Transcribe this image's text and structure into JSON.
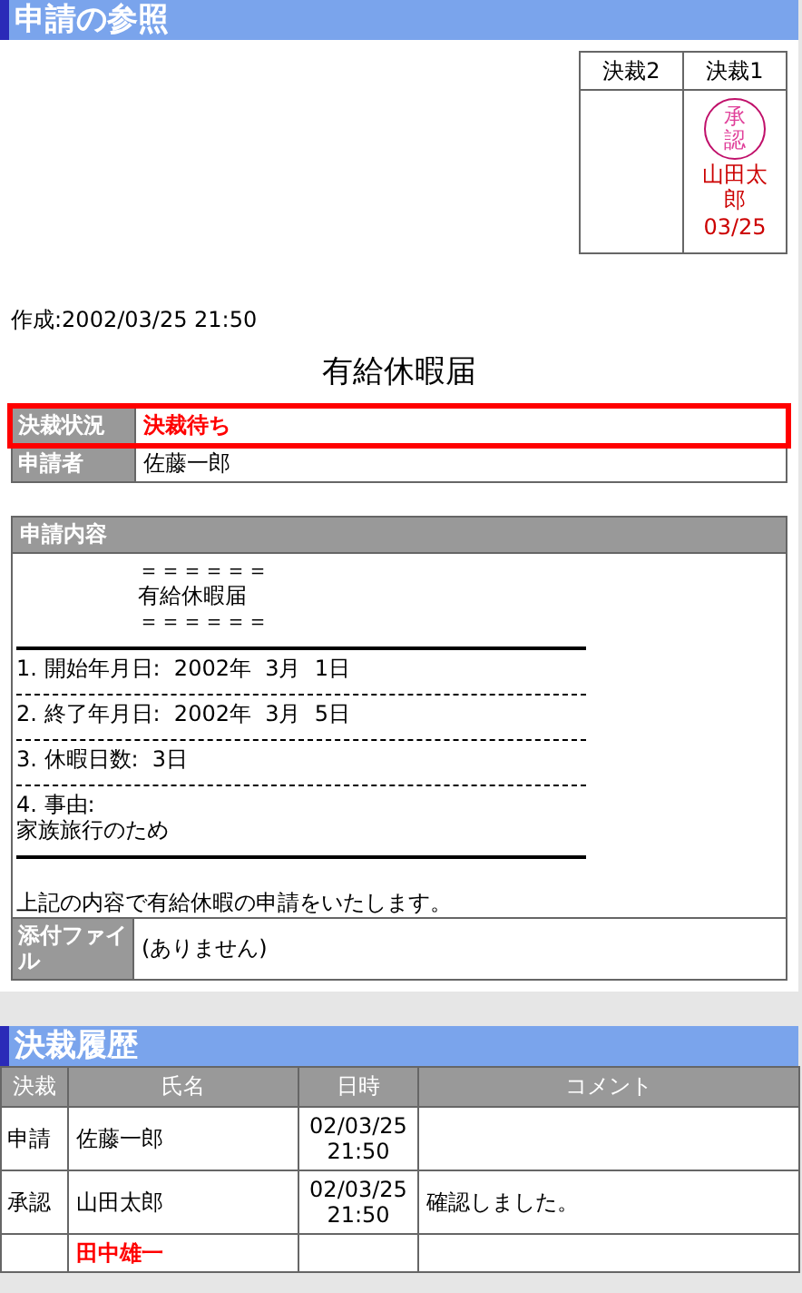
{
  "page_header": {
    "title": "申請の参照"
  },
  "stamp_box": {
    "columns": [
      {
        "label": "決裁2",
        "approved": false
      },
      {
        "label": "決裁1",
        "approved": true,
        "stamp": "承認",
        "name": "山田太郎",
        "date": "03/25"
      }
    ]
  },
  "created": "作成:2002/03/25 21:50",
  "document_title": "有給休暇届",
  "info_rows": [
    {
      "label": "決裁状況",
      "value": "決裁待ち",
      "highlighted": true
    },
    {
      "label": "申請者",
      "value": "佐藤一郎",
      "highlighted": false
    }
  ],
  "content": {
    "header": "申請内容",
    "lines": [
      {
        "kind": "indented",
        "text": "＝＝＝＝＝＝"
      },
      {
        "kind": "indented",
        "text": "有給休暇届"
      },
      {
        "kind": "indented",
        "text": "＝＝＝＝＝＝"
      },
      {
        "kind": "rule"
      },
      {
        "kind": "text",
        "text": "1. 開始年月日:  2002年  3月  1日"
      },
      {
        "kind": "dashes"
      },
      {
        "kind": "text",
        "text": "2. 終了年月日:  2002年  3月  5日"
      },
      {
        "kind": "dashes"
      },
      {
        "kind": "text",
        "text": "3. 休暇日数:  3日"
      },
      {
        "kind": "dashes"
      },
      {
        "kind": "text",
        "text": "4. 事由:"
      },
      {
        "kind": "text",
        "text": "家族旅行のため"
      },
      {
        "kind": "rule"
      },
      {
        "kind": "blank"
      },
      {
        "kind": "text",
        "text": "上記の内容で有給休暇の申請をいたします。"
      }
    ],
    "attachment": {
      "label": "添付ファイル",
      "value": "(ありません)"
    }
  },
  "history": {
    "title": "決裁履歴",
    "columns": [
      "決裁",
      "氏名",
      "日時",
      "コメント"
    ],
    "rows": [
      {
        "action": "申請",
        "name": "佐藤一郎",
        "date": "02/03/25",
        "time": "21:50",
        "pending": false
      },
      {
        "action": "承認",
        "name": "山田太郎",
        "date": "02/03/25",
        "time": "21:50",
        "comment": "確認しました。",
        "pending": false
      },
      {
        "name": "田中雄一",
        "pending": true
      }
    ]
  }
}
